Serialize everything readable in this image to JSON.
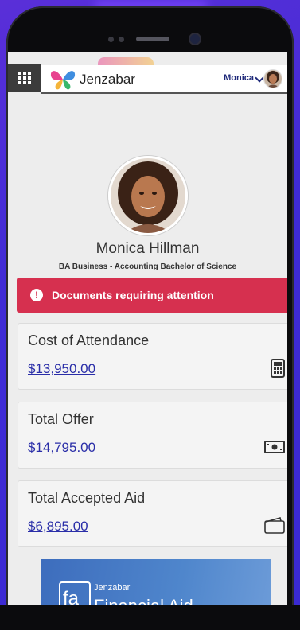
{
  "header": {
    "brand": "Jenzabar",
    "user_name": "Monica"
  },
  "profile": {
    "name": "Monica Hillman",
    "degree": "BA Business - Accounting Bachelor of Science"
  },
  "alert": {
    "text": "Documents requiring attention"
  },
  "cards": [
    {
      "title": "Cost of Attendance",
      "value": "$13,950.00",
      "icon": "calculator-icon"
    },
    {
      "title": "Total Offer",
      "value": "$14,795.00",
      "icon": "cash-icon"
    },
    {
      "title": "Total Accepted Aid",
      "value": "$6,895.00",
      "icon": "wallet-icon"
    }
  ],
  "promo": {
    "icon_text": "fa",
    "brand": "Jenzabar",
    "title": "Financial Aid"
  },
  "colors": {
    "background": "#4a2fd8",
    "alert": "#d6304f",
    "link": "#2a2ea8",
    "header_text": "#1f2a7a"
  }
}
